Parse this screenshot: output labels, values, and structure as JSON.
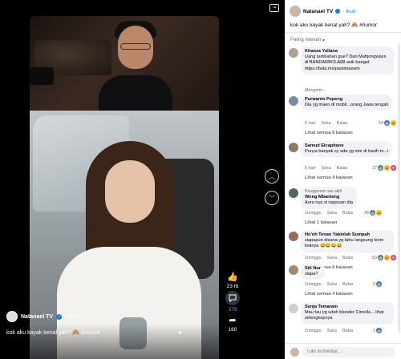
{
  "video": {
    "owner_name": "Natanael TV",
    "follow_label": "Ikuti",
    "caption": "kok aku kayak kenal yah? 🙈 #humor",
    "mute_icon": "volume-icon"
  },
  "side_actions": {
    "like_count": "23 rb",
    "comment_count": "375",
    "share_count": "160"
  },
  "panel": {
    "owner_name": "Natanael TV",
    "follow_label": "Ikuti",
    "caption": "kok aku kayak kenal yah? 🙈 #humor",
    "sort_label": "Paling relevan",
    "input_placeholder": "Tulis komentar..."
  },
  "comments": [
    {
      "name": "Khanza Yuliana",
      "text": "Uang tambahan gue? Dari Mahjongways di BANDARBOLA88 asik banget https://bola.mx/pastimaxwin",
      "time": "Mengirim..."
    },
    {
      "name": "Purwanto Pepeng",
      "text": "Dia yg maen di mobil...orang Jawa tengah",
      "time": "6 hari",
      "like": "Suka",
      "reply": "Balas",
      "count": "54",
      "replies": "Lihat semua 6 balasan"
    },
    {
      "name": "Samud Elcapitano",
      "text": "Punya banyak sy ada yg mie di kasih m...i",
      "time": "6 hari",
      "like": "Suka",
      "reply": "Balas",
      "count": "37",
      "replies": "Lihat semua 4 balasan"
    },
    {
      "badge": "Penggemar nan aktif",
      "name": "Wong Mbanteng",
      "text": "Aura nya si napsuan dia",
      "time": "1minggu",
      "like": "Suka",
      "reply": "Balas",
      "count": "36",
      "replies": "Lihat 1 balasan"
    },
    {
      "name": "Ho'oh Tenan Yakinlah Sumpah",
      "text": "siapapun disana yg tahu langsung kirim linknya 😂😂😂😂",
      "time": "1minggu",
      "like": "Suka",
      "reply": "Balas",
      "count": "53",
      "replies": "Lihat semua 6 balasan"
    },
    {
      "name": "Siti Nur",
      "text": "siapa?",
      "time": "1minggu",
      "like": "Suka",
      "reply": "Balas",
      "count": "9",
      "replies": "Lihat semua 4 balasan"
    },
    {
      "name": "Senja Temaram",
      "text": "Mau tau yg udah blunder Cimolla... lihat selengkapnya",
      "time": "1minggu",
      "like": "Suka",
      "reply": "Balas",
      "count": "1"
    }
  ]
}
